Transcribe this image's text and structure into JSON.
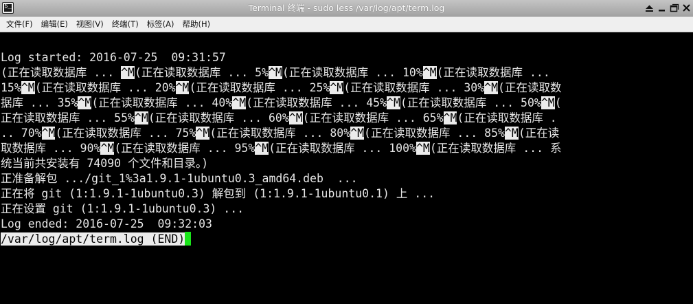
{
  "window": {
    "title": "Terminal 终端 - sudo less /var/log/apt/term.log",
    "icon": "terminal-icon",
    "controls": [
      "shade-icon",
      "minimize-icon",
      "maximize-icon",
      "close-icon"
    ]
  },
  "menu": {
    "items": [
      {
        "label": "文件(F)"
      },
      {
        "label": "编辑(E)"
      },
      {
        "label": "视图(V)"
      },
      {
        "label": "终端(T)"
      },
      {
        "label": "标签(A)"
      },
      {
        "label": "帮助(H)"
      }
    ]
  },
  "terminal": {
    "colors": {
      "background": "#000000",
      "text": "#e6e6e6",
      "cursor": "#1ae51a"
    },
    "lines": [
      [
        {
          "t": "Log started: 2016-07-25  09:31:57"
        }
      ],
      [
        {
          "t": "(正在读取数据库 ... "
        },
        {
          "t": "^M",
          "inv": true
        },
        {
          "t": "(正在读取数据库 ... 5%"
        },
        {
          "t": "^M",
          "inv": true
        },
        {
          "t": "(正在读取数据库 ... 10%"
        },
        {
          "t": "^M",
          "inv": true
        },
        {
          "t": "(正在读取数据库 ..."
        }
      ],
      [
        {
          "t": "15%"
        },
        {
          "t": "^M",
          "inv": true
        },
        {
          "t": "(正在读取数据库 ... 20%"
        },
        {
          "t": "^M",
          "inv": true
        },
        {
          "t": "(正在读取数据库 ... 25%"
        },
        {
          "t": "^M",
          "inv": true
        },
        {
          "t": "(正在读取数据库 ... 30%"
        },
        {
          "t": "^M",
          "inv": true
        },
        {
          "t": "(正在读取数"
        }
      ],
      [
        {
          "t": "据库 ... 35%"
        },
        {
          "t": "^M",
          "inv": true
        },
        {
          "t": "(正在读取数据库 ... 40%"
        },
        {
          "t": "^M",
          "inv": true
        },
        {
          "t": "(正在读取数据库 ... 45%"
        },
        {
          "t": "^M",
          "inv": true
        },
        {
          "t": "(正在读取数据库 ... 50%"
        },
        {
          "t": "^M",
          "inv": true
        },
        {
          "t": "("
        }
      ],
      [
        {
          "t": "正在读取数据库 ... 55%"
        },
        {
          "t": "^M",
          "inv": true
        },
        {
          "t": "(正在读取数据库 ... 60%"
        },
        {
          "t": "^M",
          "inv": true
        },
        {
          "t": "(正在读取数据库 ... 65%"
        },
        {
          "t": "^M",
          "inv": true
        },
        {
          "t": "(正在读取数据库 ."
        }
      ],
      [
        {
          "t": ".. 70%"
        },
        {
          "t": "^M",
          "inv": true
        },
        {
          "t": "(正在读取数据库 ... 75%"
        },
        {
          "t": "^M",
          "inv": true
        },
        {
          "t": "(正在读取数据库 ... 80%"
        },
        {
          "t": "^M",
          "inv": true
        },
        {
          "t": "(正在读取数据库 ... 85%"
        },
        {
          "t": "^M",
          "inv": true
        },
        {
          "t": "(正在读"
        }
      ],
      [
        {
          "t": "取数据库 ... 90%"
        },
        {
          "t": "^M",
          "inv": true
        },
        {
          "t": "(正在读取数据库 ... 95%"
        },
        {
          "t": "^M",
          "inv": true
        },
        {
          "t": "(正在读取数据库 ... 100%"
        },
        {
          "t": "^M",
          "inv": true
        },
        {
          "t": "(正在读取数据库 ... 系"
        }
      ],
      [
        {
          "t": "统当前共安装有 74090 个文件和目录。)"
        }
      ],
      [
        {
          "t": "正准备解包 .../git_1%3a1.9.1-1ubuntu0.3_amd64.deb  ..."
        }
      ],
      [
        {
          "t": "正在将 git (1:1.9.1-1ubuntu0.3) 解包到 (1:1.9.1-1ubuntu0.1) 上 ..."
        }
      ],
      [
        {
          "t": "正在设置 git (1:1.9.1-1ubuntu0.3) ..."
        }
      ],
      [
        {
          "t": "Log ended: 2016-07-25  09:32:03"
        }
      ],
      [
        {
          "t": "/var/log/apt/term.log (END)",
          "inv": true,
          "cursor": true
        }
      ]
    ]
  }
}
